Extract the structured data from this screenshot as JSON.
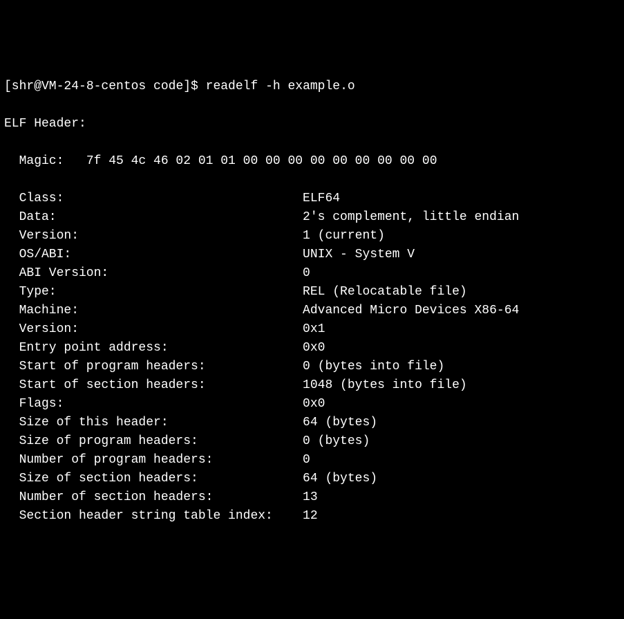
{
  "prompt": {
    "user_host": "[shr@VM-24-8-centos code]$ ",
    "command": "readelf -h example.o"
  },
  "header_title": "ELF Header:",
  "magic": {
    "label": "Magic:   ",
    "value": "7f 45 4c 46 02 01 01 00 00 00 00 00 00 00 00 00 "
  },
  "fields": [
    {
      "label": "Class:",
      "value": "ELF64"
    },
    {
      "label": "Data:",
      "value": "2's complement, little endian"
    },
    {
      "label": "Version:",
      "value": "1 (current)"
    },
    {
      "label": "OS/ABI:",
      "value": "UNIX - System V"
    },
    {
      "label": "ABI Version:",
      "value": "0"
    },
    {
      "label": "Type:",
      "value": "REL (Relocatable file)"
    },
    {
      "label": "Machine:",
      "value": "Advanced Micro Devices X86-64"
    },
    {
      "label": "Version:",
      "value": "0x1"
    },
    {
      "label": "Entry point address:",
      "value": "0x0"
    },
    {
      "label": "Start of program headers:",
      "value": "0 (bytes into file)"
    },
    {
      "label": "Start of section headers:",
      "value": "1048 (bytes into file)"
    },
    {
      "label": "Flags:",
      "value": "0x0"
    },
    {
      "label": "Size of this header:",
      "value": "64 (bytes)"
    },
    {
      "label": "Size of program headers:",
      "value": "0 (bytes)"
    },
    {
      "label": "Number of program headers:",
      "value": "0"
    },
    {
      "label": "Size of section headers:",
      "value": "64 (bytes)"
    },
    {
      "label": "Number of section headers:",
      "value": "13"
    },
    {
      "label": "Section header string table index:",
      "value": "12"
    }
  ]
}
